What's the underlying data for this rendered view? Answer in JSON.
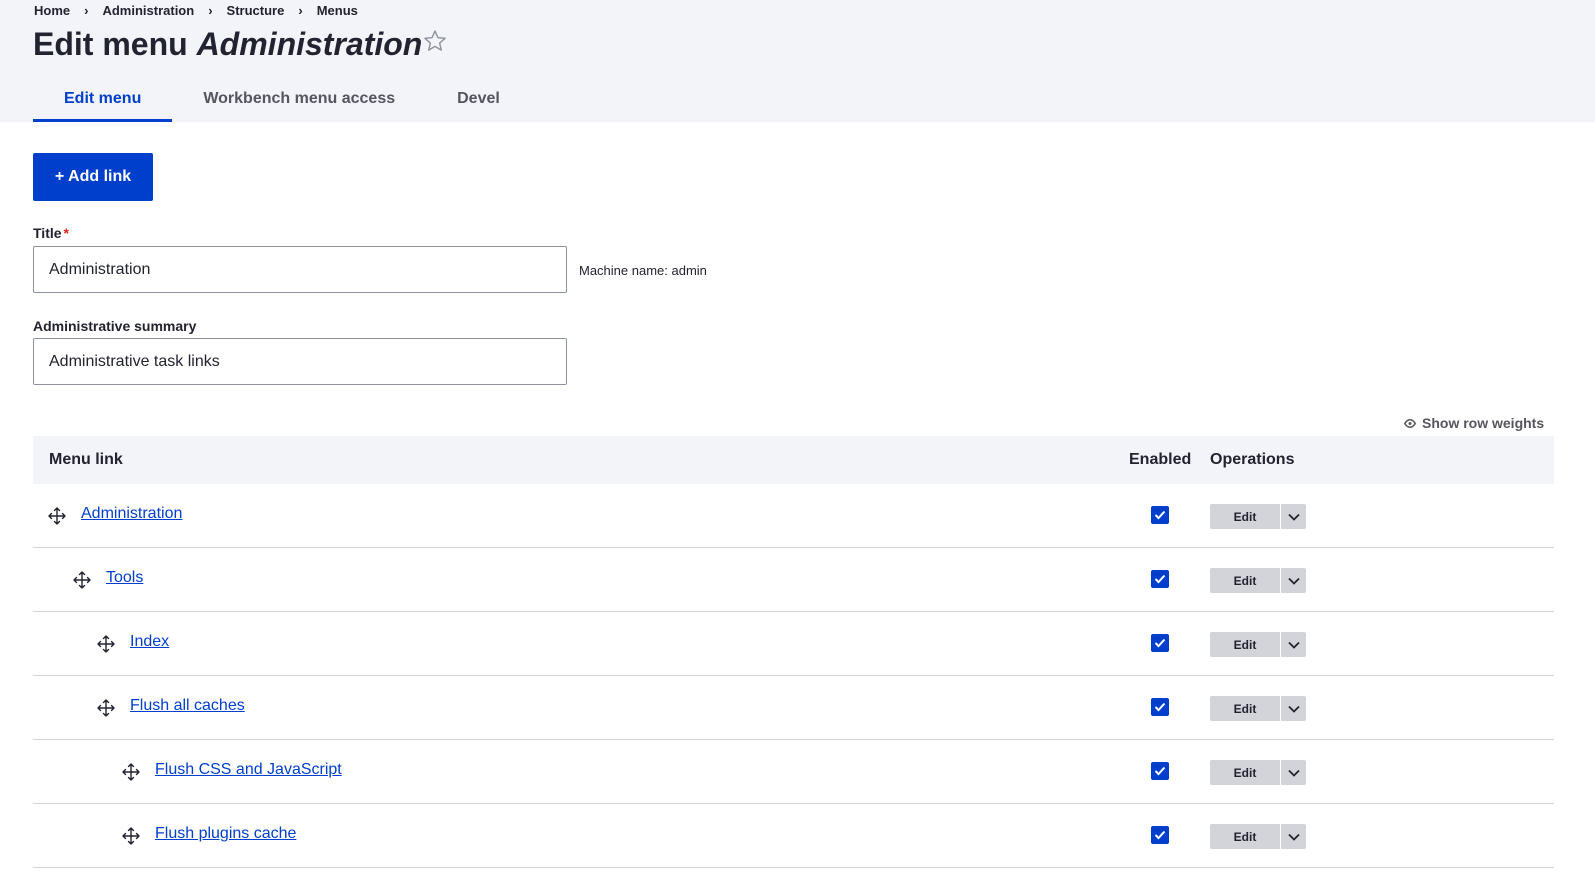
{
  "breadcrumb": [
    "Home",
    "Administration",
    "Structure",
    "Menus"
  ],
  "breadcrumb_separator": "›",
  "page_title": {
    "prefix": "Edit menu",
    "name": "Administration"
  },
  "tabs": [
    {
      "label": "Edit menu",
      "active": true
    },
    {
      "label": "Workbench menu access",
      "active": false
    },
    {
      "label": "Devel",
      "active": false
    }
  ],
  "add_link_label": "+ Add link",
  "title_field": {
    "label": "Title",
    "required_mark": "*",
    "value": "Administration"
  },
  "machine_name": "Machine name: admin",
  "summary_field": {
    "label": "Administrative summary",
    "value": "Administrative task links"
  },
  "show_row_weights": "Show row weights",
  "table": {
    "headers": {
      "menu_link": "Menu link",
      "enabled": "Enabled",
      "operations": "Operations"
    },
    "rows": [
      {
        "title": "Administration",
        "depth": 0,
        "enabled": true,
        "op_label": "Edit"
      },
      {
        "title": "Tools",
        "depth": 1,
        "enabled": true,
        "op_label": "Edit"
      },
      {
        "title": "Index",
        "depth": 2,
        "enabled": true,
        "op_label": "Edit"
      },
      {
        "title": "Flush all caches",
        "depth": 2,
        "enabled": true,
        "op_label": "Edit"
      },
      {
        "title": "Flush CSS and JavaScript",
        "depth": 3,
        "enabled": true,
        "op_label": "Edit"
      },
      {
        "title": "Flush plugins cache",
        "depth": 3,
        "enabled": true,
        "op_label": "Edit"
      }
    ]
  },
  "colors": {
    "accent": "#003ecc",
    "header_bg": "#f3f4f9",
    "required": "#dc2323",
    "button_gray": "#d3d4d9"
  }
}
